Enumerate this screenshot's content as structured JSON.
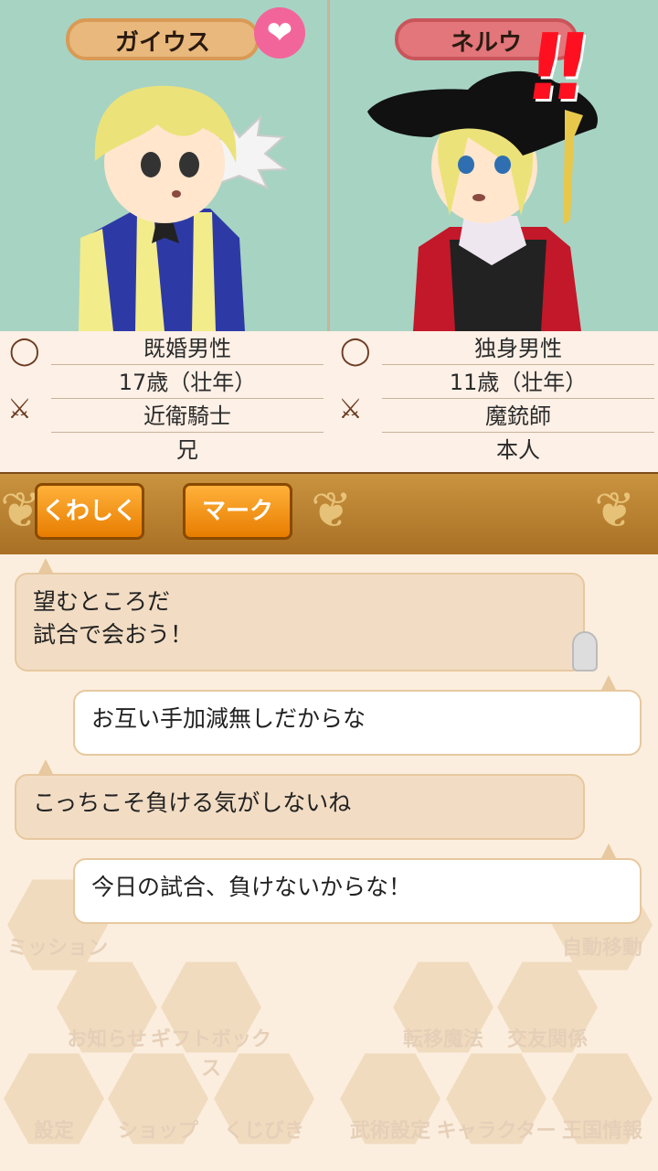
{
  "characters": {
    "left": {
      "name": "ガイウス",
      "status": "既婚男性",
      "age": "17歳（壮年）",
      "job": "近衛騎士",
      "relation": "兄"
    },
    "right": {
      "name": "ネルウ",
      "status": "独身男性",
      "age": "11歳（壮年）",
      "job": "魔銃師",
      "relation": "本人"
    }
  },
  "actions": {
    "detail": "くわしく",
    "mark": "マーク"
  },
  "dialogue": [
    {
      "line1": "望むところだ",
      "line2": "試合で会おう！"
    },
    {
      "line1": "お互い手加減無しだからな"
    },
    {
      "line1": "こっちこそ負ける気がしないね"
    },
    {
      "line1": "今日の試合、負けないからな！"
    }
  ],
  "menu": {
    "mission": "ミッション",
    "auto_move": "自動移動",
    "news": "お知らせ",
    "giftbox": "ギフトボックス",
    "transfer_magic": "転移魔法",
    "friends": "交友関係",
    "settings": "設定",
    "shop": "ショップ",
    "lottery": "くじびき",
    "martial_settings": "武術設定",
    "character": "キャラクター",
    "kingdom_info": "王国情報"
  },
  "colors": {
    "portrait_bg": "#a7d3c3",
    "accent_orange": "#e77d00",
    "heart": "#f2659b"
  }
}
